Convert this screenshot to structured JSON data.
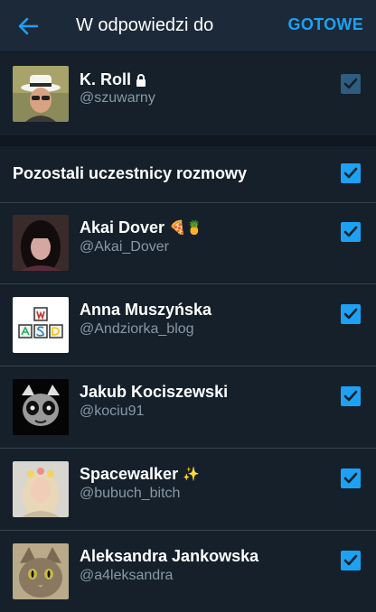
{
  "header": {
    "title": "W odpowiedzi do",
    "done_label": "GOTOWE"
  },
  "author": {
    "name": "K. Roll",
    "handle": "@szuwarny",
    "checked": true,
    "disabled": true
  },
  "section": {
    "title": "Pozostali uczestnicy rozmowy",
    "checked": true
  },
  "participants": [
    {
      "name": "Akai Dover",
      "handle": "@Akai_Dover",
      "emoji": "🍕🍍",
      "checked": true
    },
    {
      "name": "Anna Muszyńska",
      "handle": "@Andziorka_blog",
      "emoji": "",
      "checked": true
    },
    {
      "name": "Jakub Kociszewski",
      "handle": "@kociu91",
      "emoji": "",
      "checked": true
    },
    {
      "name": "Spacewalker",
      "handle": "@bubuch_bitch",
      "emoji": "✨",
      "checked": true
    },
    {
      "name": "Aleksandra Jankowska",
      "handle": "@a4leksandra",
      "emoji": "",
      "checked": true
    }
  ],
  "colors": {
    "accent": "#1da1f2",
    "background": "#15202b",
    "topbar": "#1c2938",
    "secondary_text": "#8899a6"
  },
  "icons": {
    "back": "arrow-left-icon",
    "lock": "lock-icon",
    "check": "checkmark-icon"
  }
}
